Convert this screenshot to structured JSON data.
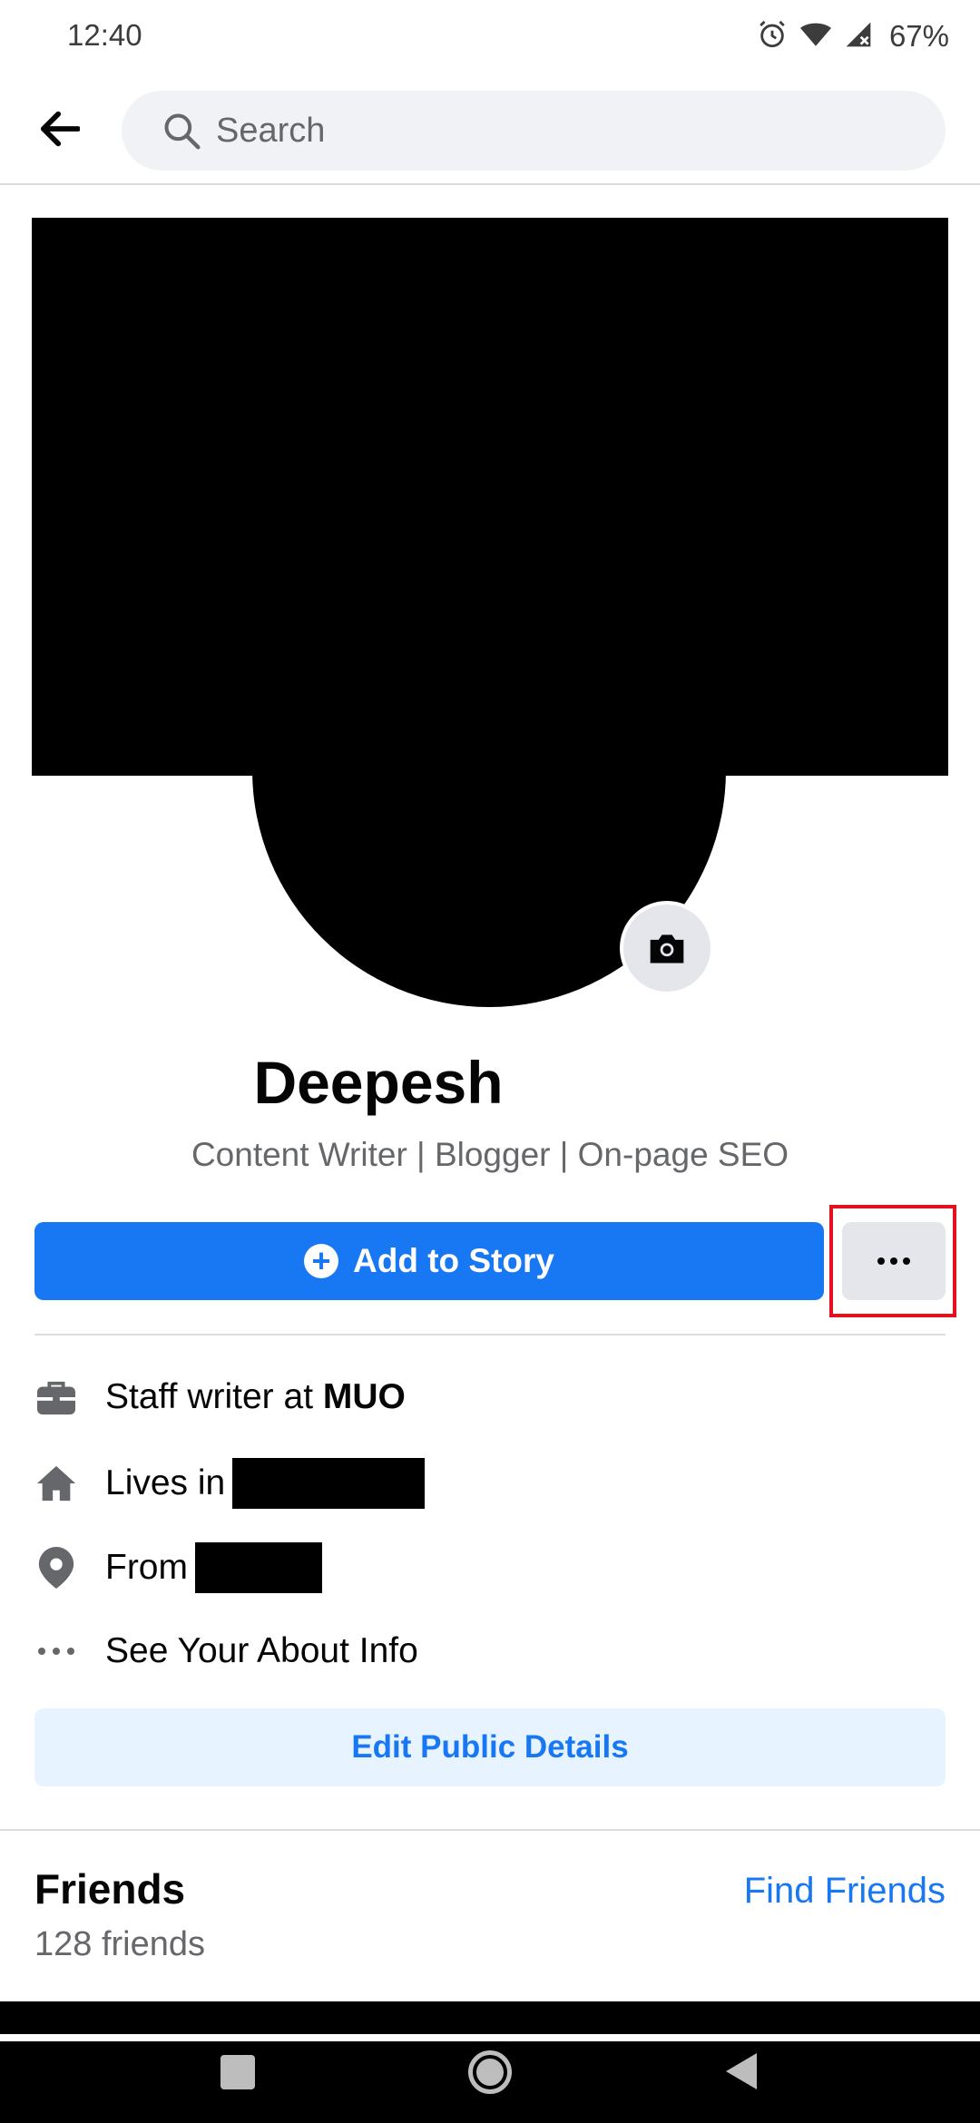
{
  "status_bar": {
    "time": "12:40",
    "battery": "67%",
    "icons": [
      "alarm-icon",
      "wifi-icon",
      "signal-icon"
    ]
  },
  "header": {
    "back_icon": "arrow-left-icon",
    "search_placeholder": "Search",
    "search_icon": "search-icon"
  },
  "profile": {
    "name": "Deepesh",
    "bio": "Content Writer | Blogger | On-page SEO",
    "camera_icon": "camera-icon"
  },
  "actions": {
    "add_to_story": "Add to Story",
    "more_icon": "more-horizontal-icon",
    "highlight_color": "#e3101e"
  },
  "info": {
    "work_prefix": "Staff writer at ",
    "work_place": "MUO",
    "lives_in": "Lives in",
    "from": "From",
    "about": "See Your About Info"
  },
  "edit_public_details": "Edit Public Details",
  "friends": {
    "title": "Friends",
    "count": "128 friends",
    "find_friends": "Find Friends"
  },
  "colors": {
    "primary": "#1877f2",
    "secondary_bg": "#e4e6eb",
    "light_blue_bg": "#e7f3ff",
    "text_secondary": "#65676b"
  }
}
